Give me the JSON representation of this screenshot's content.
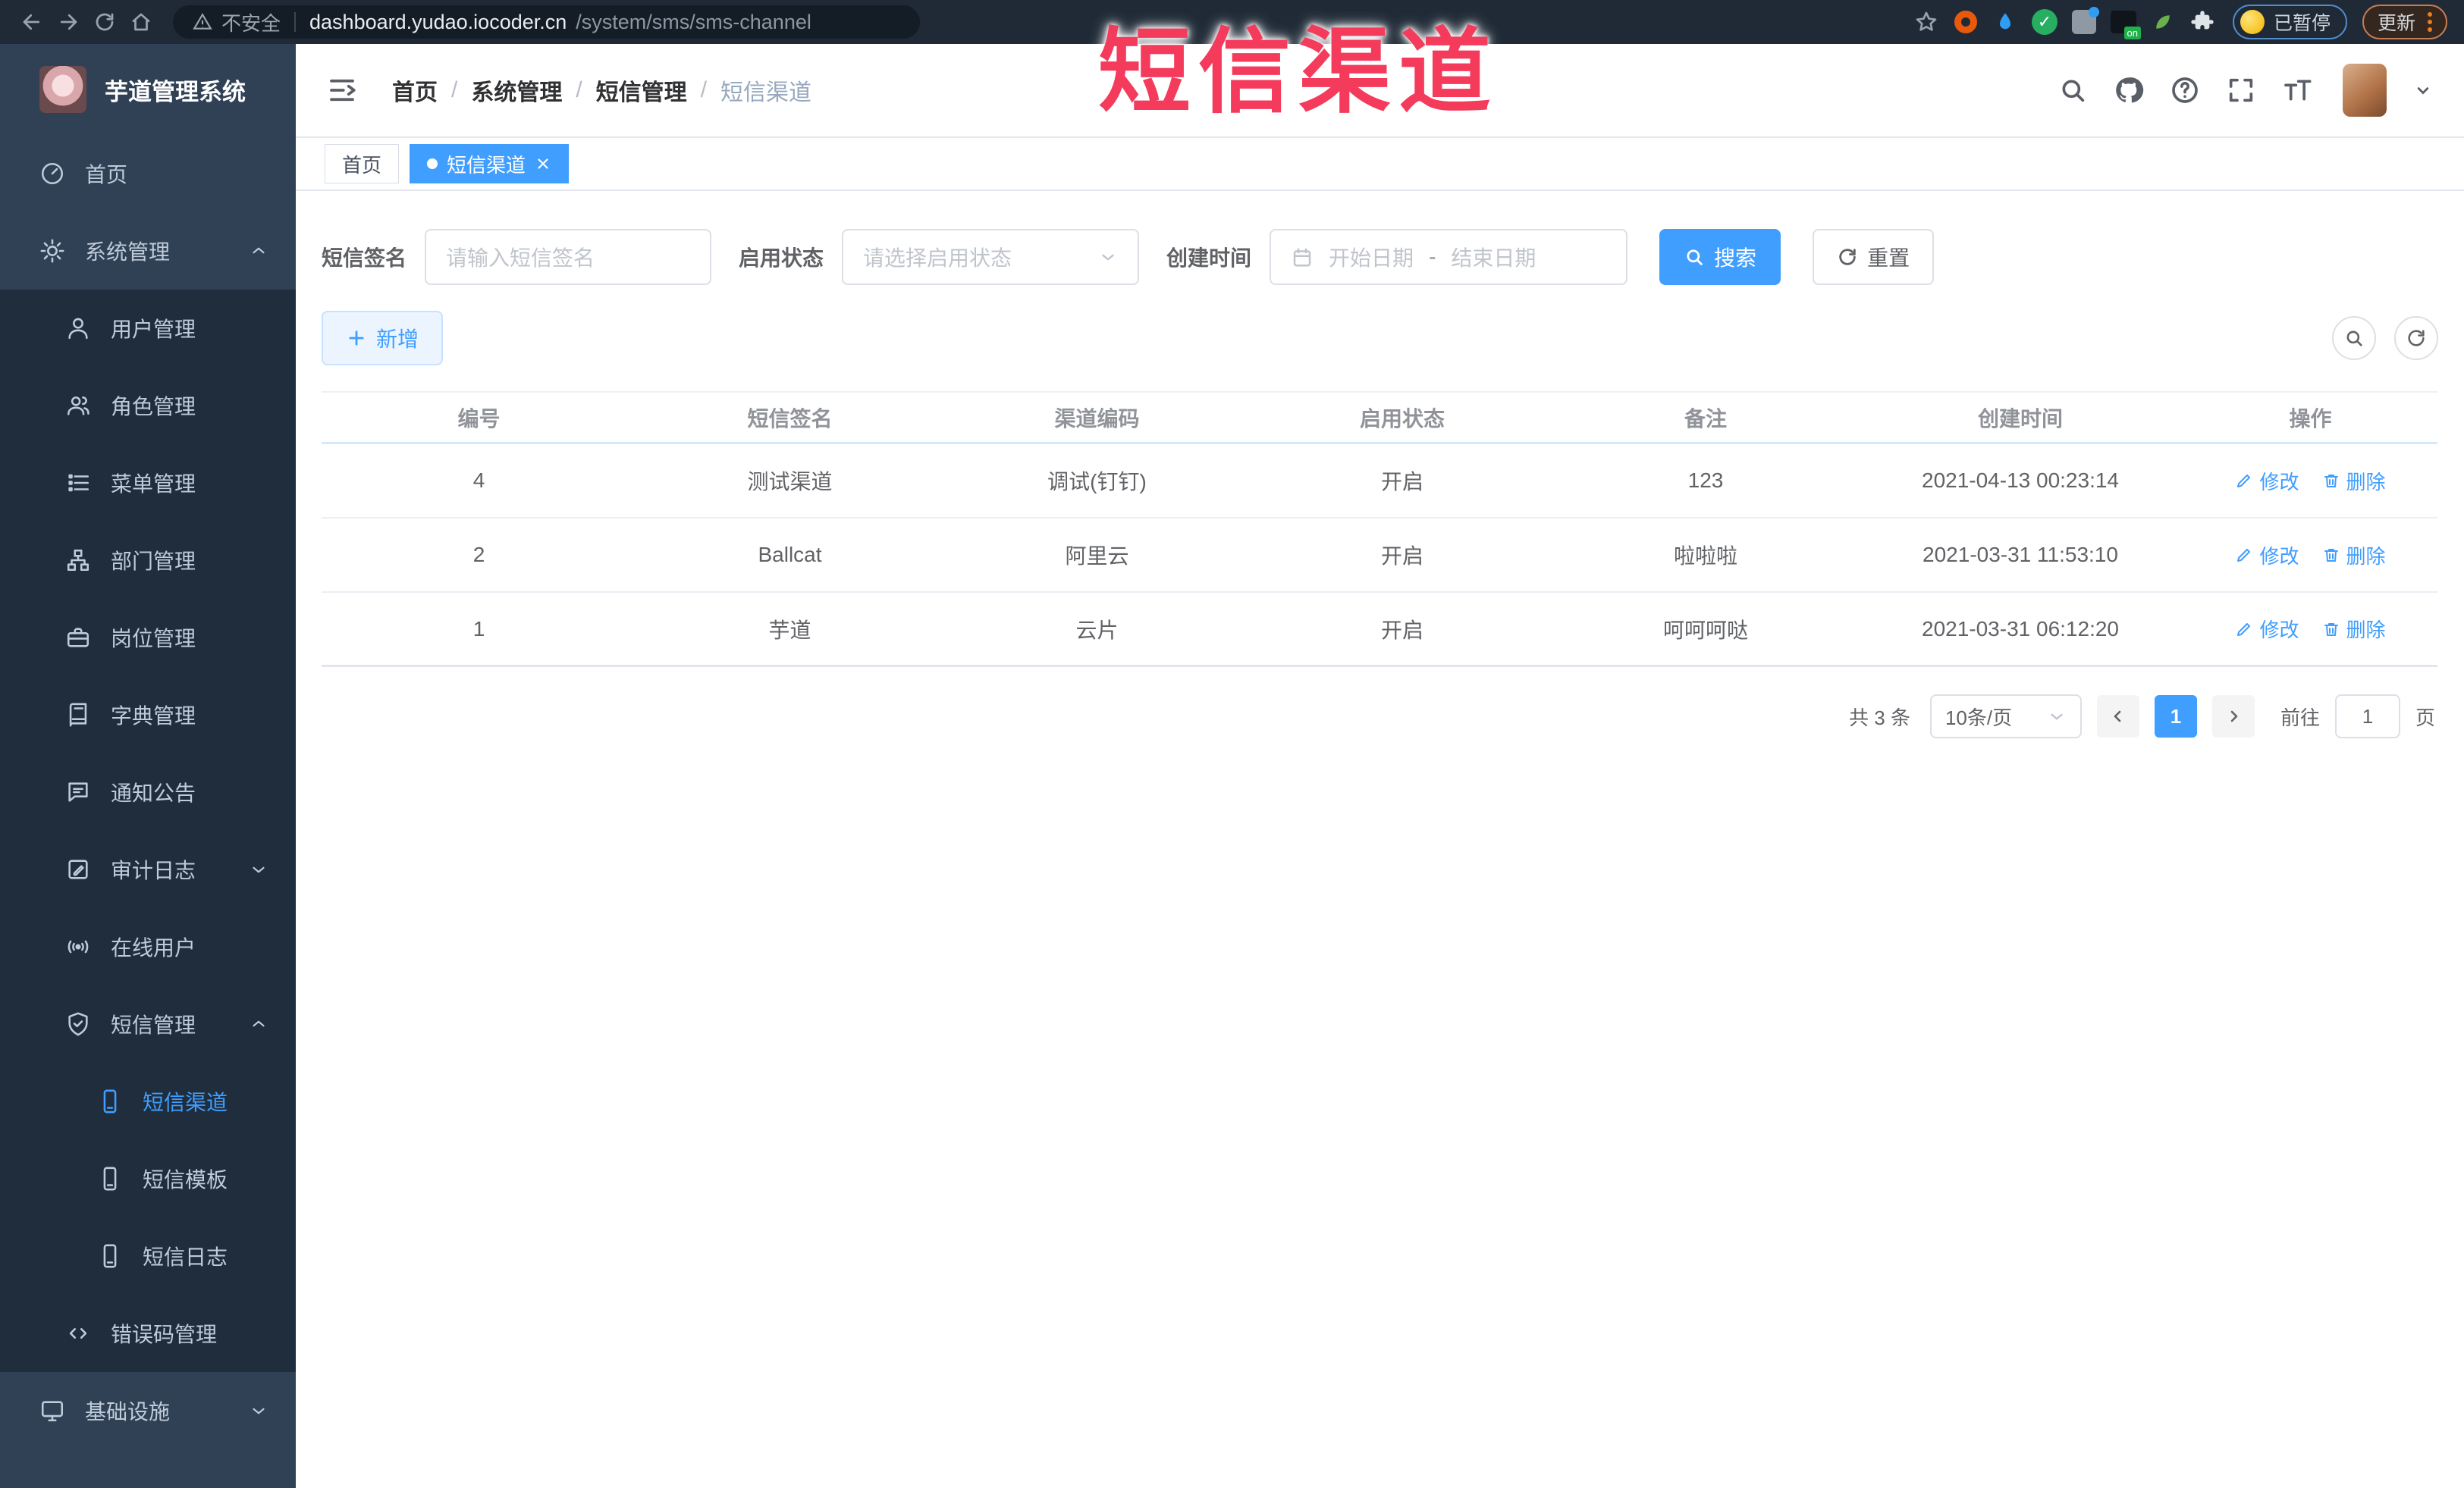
{
  "colors": {
    "accent": "#409EFF",
    "sidebar_bg": "#304156",
    "submenu_bg": "#1f2d3d",
    "overlay_red": "#f43b5c",
    "browser_bar": "#1f2a36"
  },
  "browser": {
    "security_label": "不安全",
    "url_domain": "dashboard.yudao.iocoder.cn",
    "url_path": "/system/sms/sms-channel",
    "paused_label": "已暂停",
    "update_label": "更新"
  },
  "overlay_title": "短信渠道",
  "sidebar": {
    "logo_title": "芋道管理系统",
    "items": [
      {
        "label": "首页",
        "icon": "dashboard-icon",
        "level": 1
      },
      {
        "label": "系统管理",
        "icon": "gear-icon",
        "level": 1,
        "expanded": true
      },
      {
        "label": "用户管理",
        "icon": "user-icon",
        "level": 2
      },
      {
        "label": "角色管理",
        "icon": "role-icon",
        "level": 2
      },
      {
        "label": "菜单管理",
        "icon": "menu-list-icon",
        "level": 2
      },
      {
        "label": "部门管理",
        "icon": "tree-icon",
        "level": 2
      },
      {
        "label": "岗位管理",
        "icon": "post-icon",
        "level": 2
      },
      {
        "label": "字典管理",
        "icon": "dict-icon",
        "level": 2
      },
      {
        "label": "通知公告",
        "icon": "notice-icon",
        "level": 2
      },
      {
        "label": "审计日志",
        "icon": "log-icon",
        "level": 2,
        "collapsed": true
      },
      {
        "label": "在线用户",
        "icon": "online-icon",
        "level": 2
      },
      {
        "label": "短信管理",
        "icon": "sms-shield-icon",
        "level": 2,
        "expanded": true
      },
      {
        "label": "短信渠道",
        "icon": "phone-icon",
        "level": 3,
        "active": true
      },
      {
        "label": "短信模板",
        "icon": "phone-icon",
        "level": 3
      },
      {
        "label": "短信日志",
        "icon": "phone-icon",
        "level": 3
      },
      {
        "label": "错误码管理",
        "icon": "code-icon",
        "level": 2
      },
      {
        "label": "基础设施",
        "icon": "monitor-icon",
        "level": 1,
        "collapsed": true
      }
    ]
  },
  "header": {
    "separator": "/",
    "breadcrumb": [
      {
        "label": "首页"
      },
      {
        "label": "系统管理"
      },
      {
        "label": "短信管理"
      },
      {
        "label": "短信渠道"
      }
    ]
  },
  "tabs": [
    {
      "label": "首页"
    },
    {
      "label": "短信渠道",
      "active": true
    }
  ],
  "filters": {
    "sign_label": "短信签名",
    "sign_placeholder": "请输入短信签名",
    "status_label": "启用状态",
    "status_placeholder": "请选择启用状态",
    "time_label": "创建时间",
    "start_placeholder": "开始日期",
    "separator": "-",
    "end_placeholder": "结束日期",
    "search_label": "搜索",
    "reset_label": "重置"
  },
  "toolbar": {
    "add_label": "新增"
  },
  "table": {
    "columns": [
      "编号",
      "短信签名",
      "渠道编码",
      "启用状态",
      "备注",
      "创建时间",
      "操作"
    ],
    "edit_label": "修改",
    "delete_label": "删除",
    "rows": [
      {
        "id": "4",
        "sign": "测试渠道",
        "code": "调试(钉钉)",
        "status": "开启",
        "remark": "123",
        "created": "2021-04-13 00:23:14"
      },
      {
        "id": "2",
        "sign": "Ballcat",
        "code": "阿里云",
        "status": "开启",
        "remark": "啦啦啦",
        "created": "2021-03-31 11:53:10"
      },
      {
        "id": "1",
        "sign": "芋道",
        "code": "云片",
        "status": "开启",
        "remark": "呵呵呵哒",
        "created": "2021-03-31 06:12:20"
      }
    ]
  },
  "pagination": {
    "total": "共 3 条",
    "page_size": "10条/页",
    "page": "1",
    "goto": "前往",
    "goto_value": "1",
    "unit": "页"
  }
}
